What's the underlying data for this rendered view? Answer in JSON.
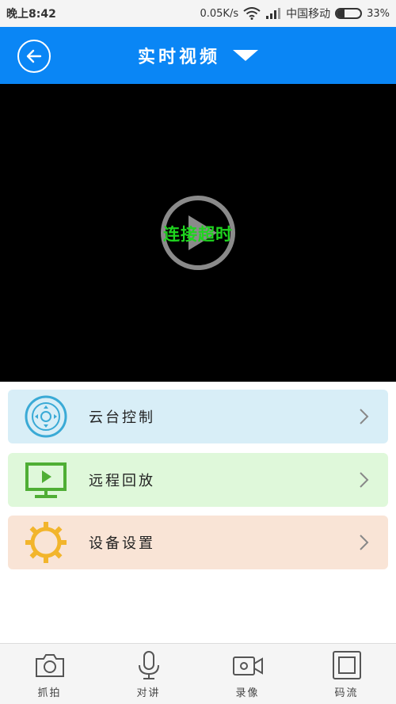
{
  "status_bar": {
    "time": "晚上8:42",
    "network_speed": "0.05K/s",
    "carrier": "中国移动",
    "battery": "33%",
    "battery_level": 0.33
  },
  "header": {
    "title": "实时视频",
    "back_icon": "back-arrow-icon",
    "dropdown_icon": "dropdown-triangle-icon",
    "accent_color": "#0a86f5"
  },
  "video": {
    "status_text": "连接超时",
    "play_icon": "play-icon",
    "status_color": "#1fd41f"
  },
  "menu": {
    "items": [
      {
        "label": "云台控制",
        "icon": "ptz-control-icon",
        "color": "#d8eef7"
      },
      {
        "label": "远程回放",
        "icon": "monitor-play-icon",
        "color": "#dff8da"
      },
      {
        "label": "设备设置",
        "icon": "gear-icon",
        "color": "#f9e4d6"
      }
    ]
  },
  "tabbar": {
    "tabs": [
      {
        "label": "抓拍",
        "icon": "camera-icon"
      },
      {
        "label": "对讲",
        "icon": "microphone-icon"
      },
      {
        "label": "录像",
        "icon": "video-record-icon"
      },
      {
        "label": "码流",
        "icon": "stream-icon"
      }
    ]
  }
}
